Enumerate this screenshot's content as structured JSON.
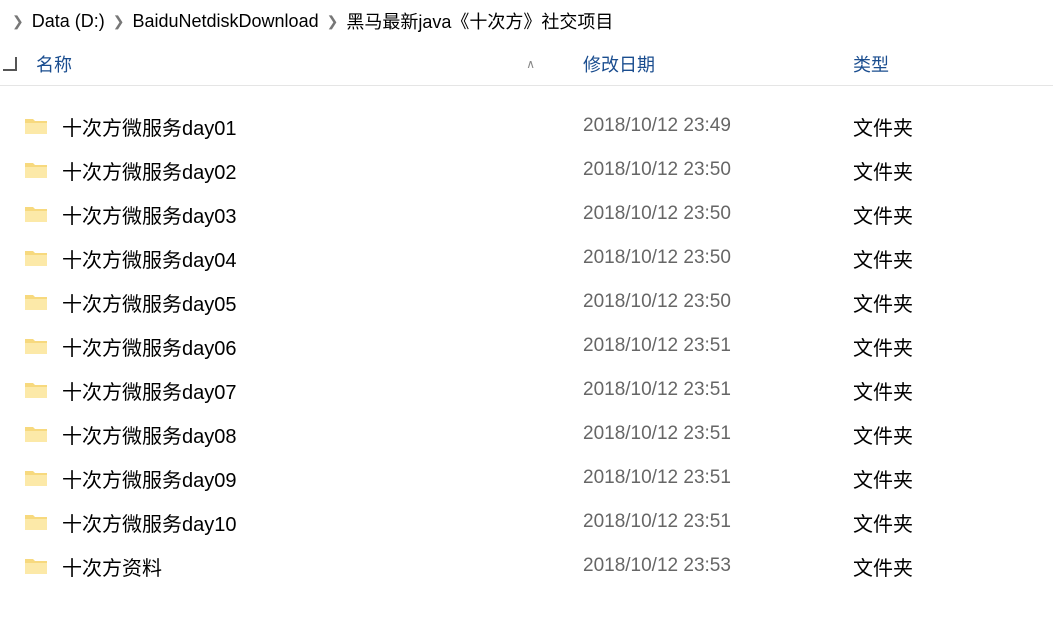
{
  "breadcrumb": {
    "items": [
      {
        "label": "Data (D:)"
      },
      {
        "label": "BaiduNetdiskDownload"
      },
      {
        "label": "黑马最新java《十次方》社交项目"
      }
    ]
  },
  "columns": {
    "name": "名称",
    "date": "修改日期",
    "type": "类型"
  },
  "files": [
    {
      "name": "十次方微服务day01",
      "date": "2018/10/12 23:49",
      "type": "文件夹"
    },
    {
      "name": "十次方微服务day02",
      "date": "2018/10/12 23:50",
      "type": "文件夹"
    },
    {
      "name": "十次方微服务day03",
      "date": "2018/10/12 23:50",
      "type": "文件夹"
    },
    {
      "name": "十次方微服务day04",
      "date": "2018/10/12 23:50",
      "type": "文件夹"
    },
    {
      "name": "十次方微服务day05",
      "date": "2018/10/12 23:50",
      "type": "文件夹"
    },
    {
      "name": "十次方微服务day06",
      "date": "2018/10/12 23:51",
      "type": "文件夹"
    },
    {
      "name": "十次方微服务day07",
      "date": "2018/10/12 23:51",
      "type": "文件夹"
    },
    {
      "name": "十次方微服务day08",
      "date": "2018/10/12 23:51",
      "type": "文件夹"
    },
    {
      "name": "十次方微服务day09",
      "date": "2018/10/12 23:51",
      "type": "文件夹"
    },
    {
      "name": "十次方微服务day10",
      "date": "2018/10/12 23:51",
      "type": "文件夹"
    },
    {
      "name": "十次方资料",
      "date": "2018/10/12 23:53",
      "type": "文件夹"
    }
  ]
}
